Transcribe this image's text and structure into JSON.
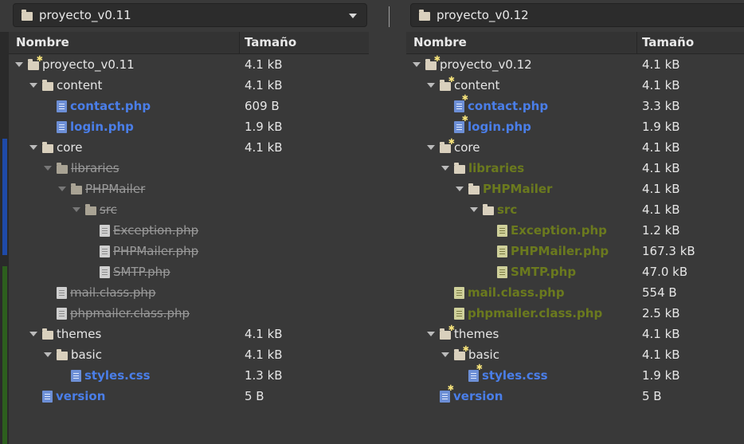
{
  "left_pane": {
    "path_label": "proyecto_v0.11",
    "columns": {
      "name": "Nombre",
      "size": "Tamaño"
    },
    "rows": [
      {
        "depth": 0,
        "type": "folder",
        "expanded": true,
        "emblem": true,
        "label": "proyecto_v0.11",
        "size": "4.1 kB",
        "style": "plain"
      },
      {
        "depth": 1,
        "type": "folder",
        "expanded": true,
        "emblem": false,
        "label": "content",
        "size": "4.1 kB",
        "style": "plain"
      },
      {
        "depth": 2,
        "type": "file",
        "icon": "blue",
        "emblem": false,
        "label": "contact.php",
        "size": "609 B",
        "style": "blue"
      },
      {
        "depth": 2,
        "type": "file",
        "icon": "blue",
        "emblem": false,
        "label": "login.php",
        "size": "1.9 kB",
        "style": "blue"
      },
      {
        "depth": 1,
        "type": "folder",
        "expanded": true,
        "emblem": false,
        "label": "core",
        "size": "4.1 kB",
        "style": "plain"
      },
      {
        "depth": 2,
        "type": "folder",
        "expanded": true,
        "emblem": false,
        "label": "libraries",
        "size": "",
        "style": "gray"
      },
      {
        "depth": 3,
        "type": "folder",
        "expanded": true,
        "emblem": false,
        "label": "PHPMailer",
        "size": "",
        "style": "gray"
      },
      {
        "depth": 4,
        "type": "folder",
        "expanded": true,
        "emblem": false,
        "label": "src",
        "size": "",
        "style": "gray"
      },
      {
        "depth": 5,
        "type": "file",
        "icon": "gray",
        "emblem": false,
        "label": "Exception.php",
        "size": "",
        "style": "gray"
      },
      {
        "depth": 5,
        "type": "file",
        "icon": "gray",
        "emblem": false,
        "label": "PHPMailer.php",
        "size": "",
        "style": "gray"
      },
      {
        "depth": 5,
        "type": "file",
        "icon": "gray",
        "emblem": false,
        "label": "SMTP.php",
        "size": "",
        "style": "gray"
      },
      {
        "depth": 2,
        "type": "file",
        "icon": "gray",
        "emblem": false,
        "label": "mail.class.php",
        "size": "",
        "style": "gray"
      },
      {
        "depth": 2,
        "type": "file",
        "icon": "gray",
        "emblem": false,
        "label": "phpmailer.class.php",
        "size": "",
        "style": "gray"
      },
      {
        "depth": 1,
        "type": "folder",
        "expanded": true,
        "emblem": false,
        "label": "themes",
        "size": "4.1 kB",
        "style": "plain"
      },
      {
        "depth": 2,
        "type": "folder",
        "expanded": true,
        "emblem": false,
        "label": "basic",
        "size": "4.1 kB",
        "style": "plain"
      },
      {
        "depth": 3,
        "type": "file",
        "icon": "blue",
        "emblem": false,
        "label": "styles.css",
        "size": "1.3 kB",
        "style": "blue"
      },
      {
        "depth": 1,
        "type": "file",
        "icon": "blue",
        "emblem": false,
        "label": "version",
        "size": "5 B",
        "style": "blue"
      }
    ]
  },
  "right_pane": {
    "path_label": "proyecto_v0.12",
    "columns": {
      "name": "Nombre",
      "size": "Tamaño"
    },
    "rows": [
      {
        "depth": 0,
        "type": "folder",
        "expanded": true,
        "emblem": true,
        "label": "proyecto_v0.12",
        "size": "4.1 kB",
        "style": "plain"
      },
      {
        "depth": 1,
        "type": "folder",
        "expanded": true,
        "emblem": true,
        "label": "content",
        "size": "4.1 kB",
        "style": "plain"
      },
      {
        "depth": 2,
        "type": "file",
        "icon": "blue",
        "emblem": true,
        "label": "contact.php",
        "size": "3.3 kB",
        "style": "blue"
      },
      {
        "depth": 2,
        "type": "file",
        "icon": "blue",
        "emblem": true,
        "label": "login.php",
        "size": "1.9 kB",
        "style": "blue"
      },
      {
        "depth": 1,
        "type": "folder",
        "expanded": true,
        "emblem": true,
        "label": "core",
        "size": "4.1 kB",
        "style": "plain"
      },
      {
        "depth": 2,
        "type": "folder",
        "expanded": true,
        "emblem": false,
        "label": "libraries",
        "size": "4.1 kB",
        "style": "olive"
      },
      {
        "depth": 3,
        "type": "folder",
        "expanded": true,
        "emblem": false,
        "label": "PHPMailer",
        "size": "4.1 kB",
        "style": "olive"
      },
      {
        "depth": 4,
        "type": "folder",
        "expanded": true,
        "emblem": false,
        "label": "src",
        "size": "4.1 kB",
        "style": "olive"
      },
      {
        "depth": 5,
        "type": "file",
        "icon": "olive",
        "emblem": false,
        "label": "Exception.php",
        "size": "1.2 kB",
        "style": "olive"
      },
      {
        "depth": 5,
        "type": "file",
        "icon": "olive",
        "emblem": false,
        "label": "PHPMailer.php",
        "size": "167.3 kB",
        "style": "olive"
      },
      {
        "depth": 5,
        "type": "file",
        "icon": "olive",
        "emblem": false,
        "label": "SMTP.php",
        "size": "47.0 kB",
        "style": "olive"
      },
      {
        "depth": 2,
        "type": "file",
        "icon": "olive",
        "emblem": false,
        "label": "mail.class.php",
        "size": "554 B",
        "style": "olive"
      },
      {
        "depth": 2,
        "type": "file",
        "icon": "olive",
        "emblem": false,
        "label": "phpmailer.class.php",
        "size": "2.5 kB",
        "style": "olive"
      },
      {
        "depth": 1,
        "type": "folder",
        "expanded": true,
        "emblem": true,
        "label": "themes",
        "size": "4.1 kB",
        "style": "plain"
      },
      {
        "depth": 2,
        "type": "folder",
        "expanded": true,
        "emblem": true,
        "label": "basic",
        "size": "4.1 kB",
        "style": "plain"
      },
      {
        "depth": 3,
        "type": "file",
        "icon": "blue",
        "emblem": true,
        "label": "styles.css",
        "size": "1.9 kB",
        "style": "blue"
      },
      {
        "depth": 1,
        "type": "file",
        "icon": "blue",
        "emblem": true,
        "label": "version",
        "size": "5 B",
        "style": "blue"
      }
    ]
  },
  "colors": {
    "background": "#393939",
    "modified": "#4a7ee8",
    "removed": "#9a9a9a",
    "added": "#6b7a1e",
    "gutter_changed": "#1f4aa8",
    "gutter_added": "#2d5f1e"
  }
}
